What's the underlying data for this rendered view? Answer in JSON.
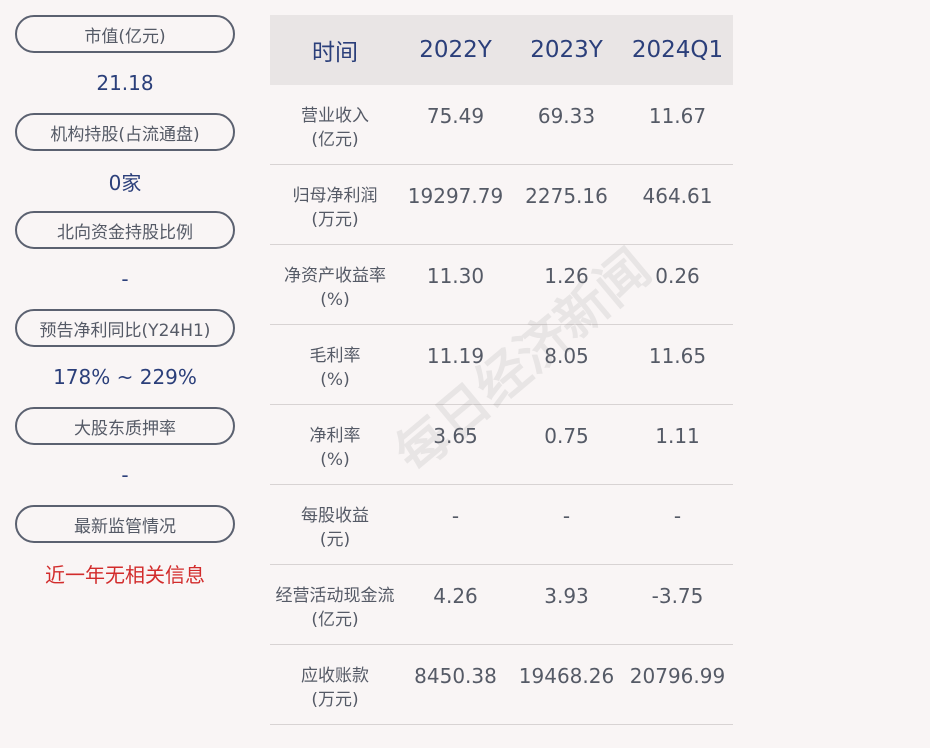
{
  "left_panel": [
    {
      "label": "市值(亿元)",
      "value": "21.18",
      "color": "#2b3f7a"
    },
    {
      "label": "机构持股(占流通盘)",
      "value": "0家",
      "color": "#2b3f7a"
    },
    {
      "label": "北向资金持股比例",
      "value": "-",
      "color": "#2b3f7a"
    },
    {
      "label": "预告净利同比(Y24H1)",
      "value": "178% ~ 229%",
      "color": "#2b3f7a"
    },
    {
      "label": "大股东质押率",
      "value": "-",
      "color": "#2b3f7a"
    },
    {
      "label": "最新监管情况",
      "value": "近一年无相关信息",
      "color": "#d22c2c"
    }
  ],
  "table": {
    "headers": [
      "时间",
      "2022Y",
      "2023Y",
      "2024Q1"
    ],
    "rows": [
      {
        "label": "营业收入",
        "unit": "(亿元)",
        "values": [
          "75.49",
          "69.33",
          "11.67"
        ]
      },
      {
        "label": "归母净利润",
        "unit": "(万元)",
        "values": [
          "19297.79",
          "2275.16",
          "464.61"
        ]
      },
      {
        "label": "净资产收益率",
        "unit": "(%)",
        "values": [
          "11.30",
          "1.26",
          "0.26"
        ]
      },
      {
        "label": "毛利率",
        "unit": "(%)",
        "values": [
          "11.19",
          "8.05",
          "11.65"
        ]
      },
      {
        "label": "净利率",
        "unit": "(%)",
        "values": [
          "3.65",
          "0.75",
          "1.11"
        ]
      },
      {
        "label": "每股收益",
        "unit": "(元)",
        "values": [
          "-",
          "-",
          "-"
        ]
      },
      {
        "label": "经营活动现金流",
        "unit": "(亿元)",
        "values": [
          "4.26",
          "3.93",
          "-3.75"
        ]
      },
      {
        "label": "应收账款",
        "unit": "(万元)",
        "values": [
          "8450.38",
          "19468.26",
          "20796.99"
        ]
      }
    ]
  },
  "watermark": "每日经济新闻"
}
